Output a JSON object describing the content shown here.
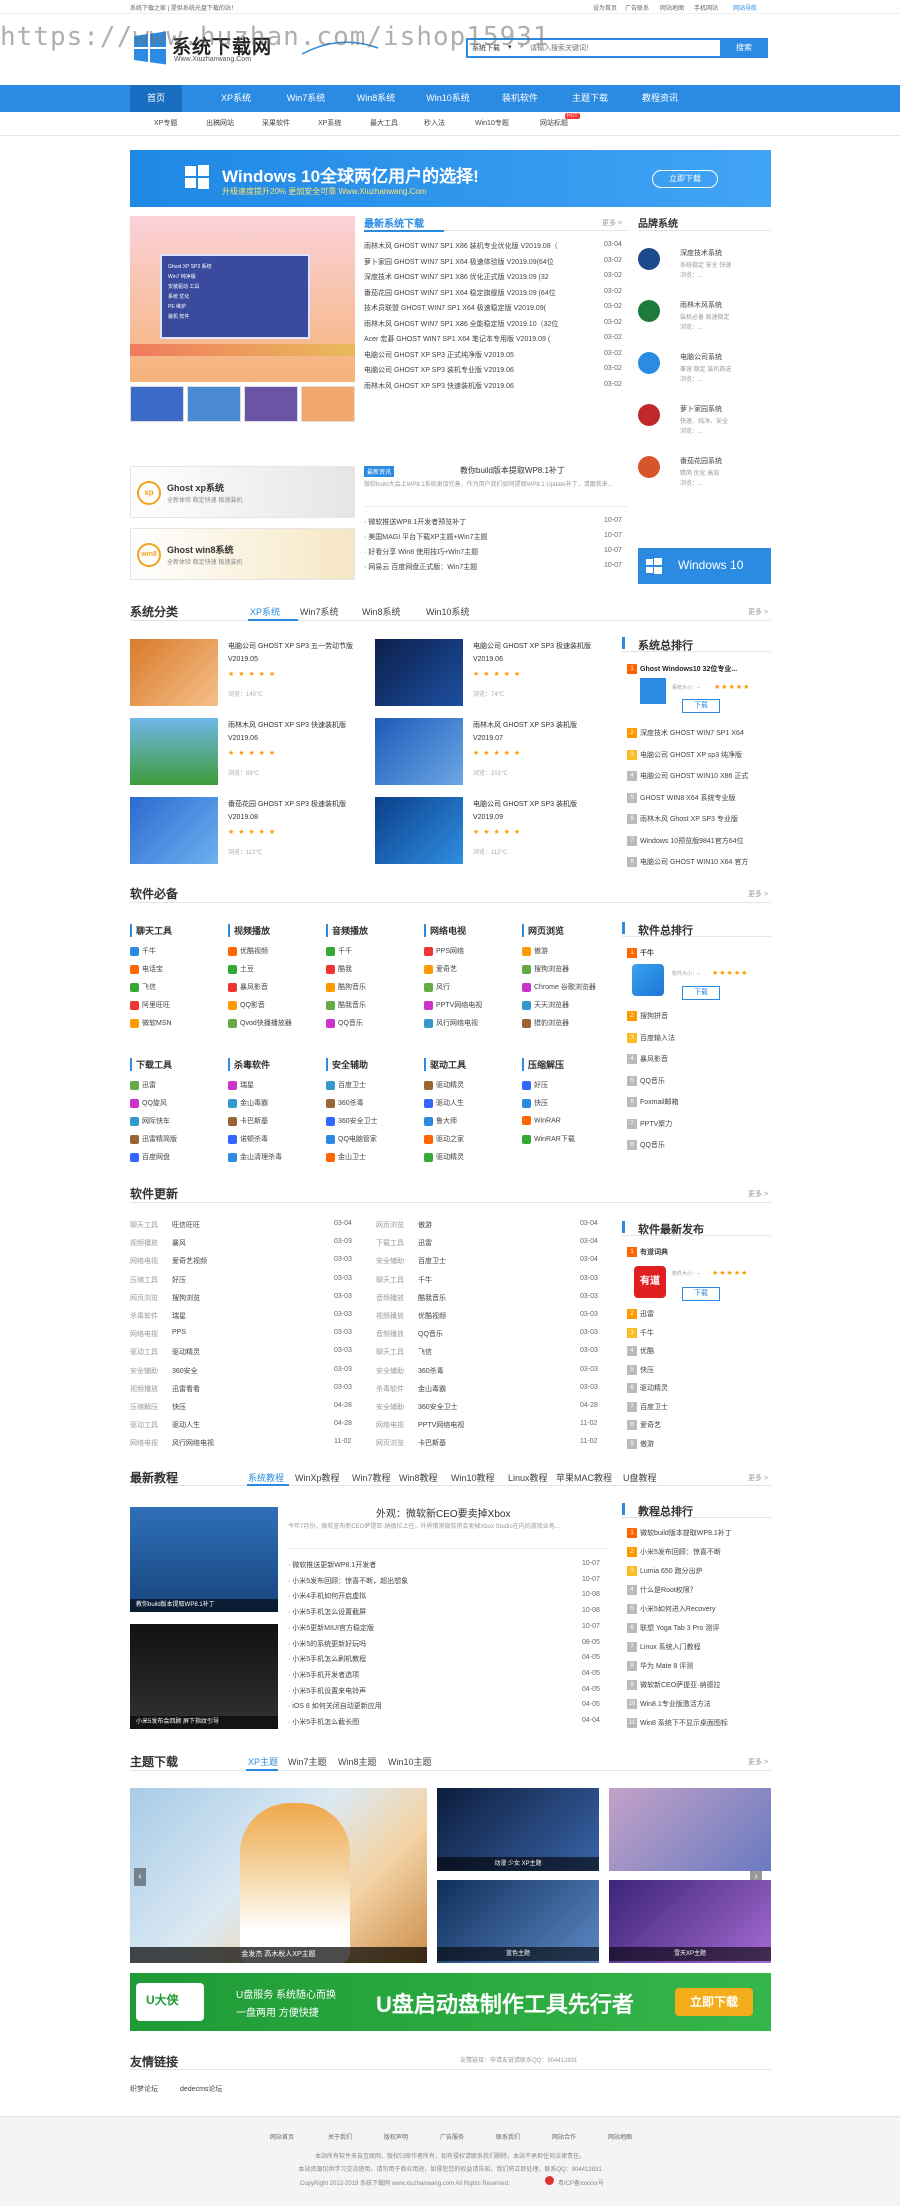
{
  "topbar": {
    "left": "系统下载之家 | 提供系统光盘下载的站！",
    "links": [
      "设为首页",
      "广告联系",
      "网站地图",
      "手机网站",
      "网站导航"
    ]
  },
  "watermark": "https://www.huzhan.com/ishop15931",
  "logo": {
    "title": "系统下载网",
    "subtitle": "Www.Xiuzhanwang.Com"
  },
  "search": {
    "category": "系统下载",
    "placeholder": "请输入搜索关键词！",
    "button": "搜索"
  },
  "nav": [
    "首页",
    "XP系统",
    "Win7系统",
    "Win8系统",
    "Win10系统",
    "装机软件",
    "主题下载",
    "教程资讯"
  ],
  "subnav": [
    "XP专题",
    "出稿网站",
    "采果软件",
    "XP系统",
    "最大工具",
    "秒入法",
    "Win10专题",
    "网站标题"
  ],
  "subnav_badge": "HOT",
  "banner": {
    "title": "Windows 10全球两亿用户的选择!",
    "sub": "升级速度提升20% 更加安全可靠 Www.Xiuzhanwang.Com",
    "button": "立即下载"
  },
  "slider_menu": [
    "Ghost XP SP3 系统",
    "Win7 纯净版",
    "安装驱动 工具",
    "系统 优化",
    "PE 维护",
    "装机 软件"
  ],
  "latest": {
    "title": "最新系统下载",
    "more": "更多 >",
    "items": [
      {
        "t": "雨林木风 GHOST WIN7 SP1 X86 装机专业优化版 V2019.08（",
        "d": "03-04"
      },
      {
        "t": "萝卜家园 GHOST WIN7 SP1 X64 极速体验版 V2019.09(64位",
        "d": "03-02"
      },
      {
        "t": "深度技术 GHOST WIN7 SP1 X86 优化正式版 V2019.09 (32",
        "d": "03-02"
      },
      {
        "t": "番茄花园 GHOST WIN7 SP1 X64 稳定旗舰版 V2019.09 (64位",
        "d": "03-02"
      },
      {
        "t": "技术员联盟 GHOST WIN7 SP1 X64 极速稳定版 V2019.09(",
        "d": "03-02"
      },
      {
        "t": "雨林木风 GHOST WIN7 SP1 X86 全能稳定版 V2019.10（32位",
        "d": "03-02"
      },
      {
        "t": "Acer 宏碁 GHOST WIN7 SP1 X64 笔记本专用版 V2019.09 (",
        "d": "03-02"
      },
      {
        "t": "电脑公司 GHOST XP SP3 正式纯净版 V2019.05",
        "d": "03-02"
      },
      {
        "t": "电脑公司 GHOST XP SP3 装机专业版 V2019.06",
        "d": "03-02"
      },
      {
        "t": "雨林木风 GHOST XP SP3 快速装机版 V2019.06",
        "d": "03-02"
      }
    ]
  },
  "brands": {
    "title": "品牌系统",
    "items": [
      {
        "name": "深度技术系统",
        "desc": "系统稳定 安全 快速",
        "views": "浏览：..."
      },
      {
        "name": "雨林木风系统",
        "desc": "装机必备 极速稳定",
        "views": "浏览：..."
      },
      {
        "name": "电脑公司系统",
        "desc": "兼容 稳定 装机首选",
        "views": "浏览：..."
      },
      {
        "name": "萝卜家园系统",
        "desc": "快速、纯净、安全",
        "views": "浏览：..."
      },
      {
        "name": "番茄花园系统",
        "desc": "精简 优化 高效",
        "views": "浏览：..."
      }
    ],
    "win10": "Windows 10"
  },
  "ghost": [
    {
      "name": "Ghost xp系统",
      "desc": "全新体验 稳定快速 极速装机"
    },
    {
      "name": "Ghost win8系统",
      "desc": "全新体验 稳定快速 极速装机"
    }
  ],
  "news_feature": {
    "badge": "最新资讯",
    "title": "教你build版本提取WP8.1补丁",
    "desc": "微软build大会上WP8.1系统更加完善，作为用户我们如何提取WP8.1 Update补丁，请跟我来..."
  },
  "news_list": [
    {
      "t": "· 微软推送WP8.1开发者预览补丁",
      "d": "10-07"
    },
    {
      "t": "· 美国MAGI 平台下载XP主题+Win7主题",
      "d": "10-07"
    },
    {
      "t": "· 好看分享 Win8 使用技巧+Win7主题",
      "d": "10-07"
    },
    {
      "t": "· 网易云 百度网盘正式版：Win7主题",
      "d": "10-07"
    }
  ],
  "syscat": {
    "title": "系统分类",
    "tabs": [
      "XP系统",
      "Win7系统",
      "Win8系统",
      "Win10系统"
    ],
    "more": "更多 >",
    "items": [
      {
        "t": "电脑公司 GHOST XP SP3 五一劳动节版 V2019.05",
        "v": "浏览：140℃"
      },
      {
        "t": "电脑公司 GHOST XP SP3 极速装机版 V2019.06",
        "v": "浏览：74℃"
      },
      {
        "t": "雨林木风 GHOST XP SP3 快速装机版 V2019.06",
        "v": "浏览：89℃"
      },
      {
        "t": "雨林木风 GHOST XP SP3 装机版 V2019.07",
        "v": "浏览：101℃"
      },
      {
        "t": "番茄花园 GHOST XP SP3 极速装机版 V2019.08",
        "v": "浏览：112℃"
      },
      {
        "t": "电脑公司 GHOST XP SP3 装机版 V2019.09",
        "v": "浏览：112℃"
      }
    ]
  },
  "sysrank": {
    "title": "系统总排行",
    "first": {
      "t": "Ghost Windows10 32位专业...",
      "sub": "系统大小：--"
    },
    "download": "下载",
    "items": [
      "深度技术 GHOST WIN7 SP1 X64",
      "电脑公司 GHOST XP sp3 纯净版",
      "电脑公司 GHOST WIN10 X86 正式",
      "GHOST WIN8 X64 系统专业版",
      "雨林木风 Ghost XP SP3 专业版",
      "Windows 10预览版9841官方64位",
      "电脑公司 GHOST WIN10 X64 官方"
    ]
  },
  "software": {
    "title": "软件必备",
    "more": "更多 >",
    "cats": [
      {
        "name": "聊天工具",
        "items": [
          "千牛",
          "电话宝",
          "飞信",
          "阿里旺旺",
          "微软MSN"
        ]
      },
      {
        "name": "视频播放",
        "items": [
          "优酷视频",
          "土豆",
          "暴风影音",
          "QQ影音",
          "Qvod快播播放器"
        ]
      },
      {
        "name": "音频播放",
        "items": [
          "千千",
          "酷我",
          "酷狗音乐",
          "酷我音乐",
          "QQ音乐"
        ]
      },
      {
        "name": "网络电视",
        "items": [
          "PPS网络",
          "爱奇艺",
          "风行",
          "PPTV网络电视",
          "风行网络电视"
        ]
      },
      {
        "name": "网页浏览",
        "items": [
          "傲游",
          "搜狗浏览器",
          "Chrome 谷歌浏览器",
          "天天浏览器",
          "猎豹浏览器"
        ]
      },
      {
        "name": "下载工具",
        "items": [
          "迅雷",
          "QQ旋风",
          "网际快车",
          "迅雷精简版",
          "百度网盘"
        ]
      },
      {
        "name": "杀毒软件",
        "items": [
          "瑞星",
          "金山毒霸",
          "卡巴斯基",
          "诺顿杀毒",
          "金山清理杀毒"
        ]
      },
      {
        "name": "安全辅助",
        "items": [
          "百度卫士",
          "360杀毒",
          "360安全卫士",
          "QQ电脑管家",
          "金山卫士"
        ]
      },
      {
        "name": "驱动工具",
        "items": [
          "驱动精灵",
          "驱动人生",
          "鲁大师",
          "驱动之家",
          "驱动精灵"
        ]
      },
      {
        "name": "压缩解压",
        "items": [
          "好压",
          "快压",
          "WinRAR",
          "WinRAR下载"
        ]
      }
    ]
  },
  "softrank": {
    "title": "软件总排行",
    "first": {
      "t": "千牛",
      "sub": "软件大小：--"
    },
    "download": "下载",
    "items": [
      "搜狗拼音",
      "百度输入法",
      "暴风影音",
      "QQ音乐",
      "Foxmail邮箱",
      "PPTV聚力",
      "QQ音乐"
    ]
  },
  "updates": {
    "title": "软件更新",
    "more": "更多 >",
    "left": [
      {
        "c": "聊天工具",
        "n": "旺信旺旺",
        "d": "03-04"
      },
      {
        "c": "视频播放",
        "n": "暴风",
        "d": "03-03"
      },
      {
        "c": "网络电视",
        "n": "爱奇艺视频",
        "d": "03-03"
      },
      {
        "c": "压缩工具",
        "n": "好压",
        "d": "03-03"
      },
      {
        "c": "网页浏览",
        "n": "搜狗浏览",
        "d": "03-03"
      },
      {
        "c": "杀毒软件",
        "n": "瑞星",
        "d": "03-03"
      },
      {
        "c": "网络电视",
        "n": "PPS",
        "d": "03-03"
      },
      {
        "c": "驱动工具",
        "n": "驱动精灵",
        "d": "03-03"
      },
      {
        "c": "安全辅助",
        "n": "360安全",
        "d": "03-03"
      },
      {
        "c": "视频播放",
        "n": "迅雷看看",
        "d": "03-03"
      },
      {
        "c": "压缩解压",
        "n": "快压",
        "d": "04-28"
      },
      {
        "c": "驱动工具",
        "n": "驱动人生",
        "d": "04-28"
      },
      {
        "c": "网络电视",
        "n": "风行网络电视",
        "d": "11-02"
      }
    ],
    "right": [
      {
        "c": "网页浏览",
        "n": "傲游",
        "d": "03-04"
      },
      {
        "c": "下载工具",
        "n": "迅雷",
        "d": "03-04"
      },
      {
        "c": "安全辅助",
        "n": "百度卫士",
        "d": "03-04"
      },
      {
        "c": "聊天工具",
        "n": "千牛",
        "d": "03-03"
      },
      {
        "c": "音频播放",
        "n": "酷我音乐",
        "d": "03-03"
      },
      {
        "c": "视频播放",
        "n": "优酷视频",
        "d": "03-03"
      },
      {
        "c": "音频播放",
        "n": "QQ音乐",
        "d": "03-03"
      },
      {
        "c": "聊天工具",
        "n": "飞信",
        "d": "03-03"
      },
      {
        "c": "安全辅助",
        "n": "360杀毒",
        "d": "03-03"
      },
      {
        "c": "杀毒软件",
        "n": "金山毒霸",
        "d": "03-03"
      },
      {
        "c": "安全辅助",
        "n": "360安全卫士",
        "d": "04-28"
      },
      {
        "c": "网络电视",
        "n": "PPTV网络电视",
        "d": "11-02"
      },
      {
        "c": "网页浏览",
        "n": "卡巴斯基",
        "d": "11-02"
      }
    ]
  },
  "softnew": {
    "title": "软件最新发布",
    "first": {
      "t": "有道词典",
      "sub": "软件大小：--"
    },
    "download": "下载",
    "items": [
      "迅雷",
      "千牛",
      "优酷",
      "快压",
      "驱动精灵",
      "百度卫士",
      "爱奇艺",
      "傲游"
    ]
  },
  "tutorials": {
    "title": "最新教程",
    "tabs": [
      "系统教程",
      "WinXp教程",
      "Win7教程",
      "Win8教程",
      "Win10教程",
      "Linux教程",
      "苹果MAC教程",
      "U盘教程"
    ],
    "more": "更多 >",
    "img1": "教你build版本提取WP8.1补丁",
    "img2": "小米5发布会回顾 屏下指纹引导",
    "feature": {
      "title": "外观：微软新CEO要卖掉Xbox",
      "desc": "今年7月份，微软宣布新CEO萨提亚·纳德拉上任，外界猜测微软将会卖掉Xbox Studio在内的游戏业务..."
    },
    "items": [
      {
        "t": "· 微软推送更新WP8.1开发者",
        "d": "10-07"
      },
      {
        "t": "· 小米5发布回顾：惊喜不断，超出想象",
        "d": "10-07"
      },
      {
        "t": "· 小米4手机如何开启虚拟",
        "d": "10-08"
      },
      {
        "t": "· 小米5手机怎么设置截屏",
        "d": "10-08"
      },
      {
        "t": "· 小米5更新MIUI官方稳定版",
        "d": "10-07"
      },
      {
        "t": "· 小米5的系统更新好玩吗",
        "d": "08-05"
      },
      {
        "t": "· 小米5手机怎么刷机教程",
        "d": "04-05"
      },
      {
        "t": "· 小米5手机开发者选项",
        "d": "04-05"
      },
      {
        "t": "· 小米5手机设置来电铃声",
        "d": "04-05"
      },
      {
        "t": "· iOS 8 如何关闭自动更新应用",
        "d": "04-05"
      },
      {
        "t": "· 小米5手机怎么截长图",
        "d": "04-04"
      }
    ]
  },
  "tutorank": {
    "title": "教程总排行",
    "items": [
      "微软build版本提取WP8.1补丁",
      "小米5发布回顾：惊喜不断",
      "Lumia 650 跑分出炉",
      "什么是Root权限？",
      "小米5如何进入Recovery",
      "联想 Yoga Tab 3 Pro 测评",
      "Linux 系统入门教程",
      "华为 Mate 8 评测",
      "微软新CEO萨提亚·纳德拉",
      "Win8.1专业版激活方法",
      "Win8 系统下不显示桌面图标"
    ]
  },
  "themes": {
    "title": "主题下载",
    "tabs": [
      "XP主题",
      "Win7主题",
      "Win8主题",
      "Win10主题"
    ],
    "more": "更多 >",
    "big": "金发杰 高木秋人XP主题",
    "captions": [
      "动漫 少女 XP主题",
      "",
      "",
      "",
      "蓝色主题",
      "雪天XP主题"
    ]
  },
  "ad": {
    "brand": "U大侠",
    "slogan1": "U盘服务  系统随心而换",
    "slogan2": "一盘两用  方便快捷",
    "main": "U盘启动盘制作工具先行者",
    "button": "立即下载"
  },
  "friends": {
    "title": "友情链接",
    "note": "友情链接：申请友链请联系QQ：904412831",
    "items": [
      "织梦论坛",
      "dedecms论坛"
    ]
  },
  "footer": {
    "links": [
      "网站首页",
      "关于我们",
      "版权声明",
      "广告服务",
      "联系我们",
      "网站合作",
      "网站地图"
    ],
    "line1": "本站所有软件来自互联网，版权归原作者所有，如有侵权请联系我们删除，本站不承担任何法律责任。",
    "line2": "本站资源仅供学习交流使用，请勿用于商业用途，如侵犯您的权益请告知，我们将立即处理。联系QQ：904412831",
    "copyright": "CopyRight 2012-2019 系统下载网 www.xiuzhanwang.com All Rights Reserved.",
    "icp": "粤ICP备xxxxxx号"
  },
  "colors": {
    "accent": "#2b8be2",
    "orange": "#f60",
    "adgreen": "#2aa739"
  }
}
